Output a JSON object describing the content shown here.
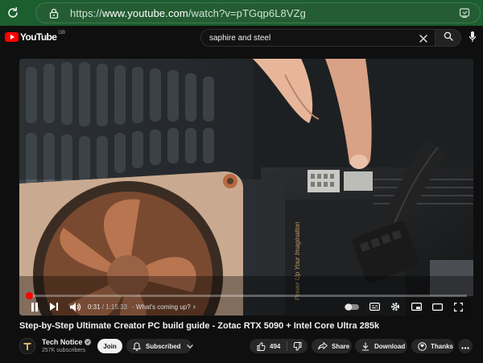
{
  "browser": {
    "url_prefix": "https://",
    "url_host": "www.youtube.com",
    "url_path": "/watch?v=pTGqp6L8VZg"
  },
  "header": {
    "logo_text": "YouTube",
    "region": "GB",
    "search_value": "saphire and steel"
  },
  "player": {
    "current_time": "0:31",
    "duration": "1:15:33",
    "time_separator": " / ",
    "chapter": "· What's coming up?",
    "chapter_arrow": "›",
    "progress_fraction": 0.007,
    "overlay_text": "Power Up Your Imagination"
  },
  "video": {
    "title": "Step-by-Step Ultimate Creator PC build guide - Zotac RTX 5090 + Intel Core Ultra 285k"
  },
  "channel": {
    "name": "Tech Notice",
    "verified_mark": "✓",
    "subscribers": "257K subscribers",
    "join_label": "Join",
    "subscribed_label": "Subscribed"
  },
  "actions": {
    "likes": "494",
    "share_label": "Share",
    "download_label": "Download",
    "thanks_label": "Thanks"
  },
  "colors": {
    "browser_green": "#1c5e2e",
    "yt_red": "#ff0000",
    "background": "#0f0f0f"
  },
  "icons": {
    "reload": "reload-icon",
    "lock": "lock-icon",
    "extension": "extension-icon",
    "search": "search-icon",
    "clear": "close-icon",
    "mic": "mic-icon",
    "pause": "pause-icon",
    "next": "next-icon",
    "volume": "volume-icon",
    "autoplay": "autoplay-toggle-icon",
    "subtitles": "subtitles-icon",
    "settings": "gear-icon",
    "miniplayer": "miniplayer-icon",
    "theater": "theater-icon",
    "fullscreen": "fullscreen-icon",
    "bell": "bell-icon",
    "like": "thumbs-up-icon",
    "dislike": "thumbs-down-icon",
    "share": "share-icon",
    "download": "download-icon",
    "thanks": "thanks-icon",
    "more": "more-icon"
  }
}
